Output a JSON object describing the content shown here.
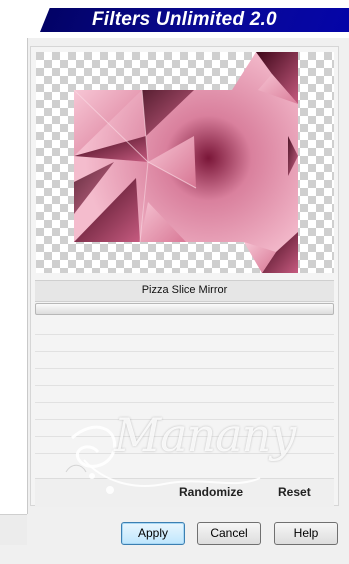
{
  "header": {
    "title": "Filters Unlimited 2.0"
  },
  "preview": {
    "effect": "pizza-slice-mirror-preview",
    "accent": "#c8456e"
  },
  "filter": {
    "name": "Pizza Slice Mirror"
  },
  "actions": {
    "randomize_label": "Randomize",
    "reset_label": "Reset"
  },
  "buttons": {
    "apply_label": "Apply",
    "cancel_label": "Cancel",
    "help_label": "Help"
  },
  "watermark": {
    "text": "Manany"
  },
  "colors": {
    "title_bar": "#0a0a96",
    "pink_light": "#f2b3c6",
    "pink_dark": "#5a0d2a"
  }
}
